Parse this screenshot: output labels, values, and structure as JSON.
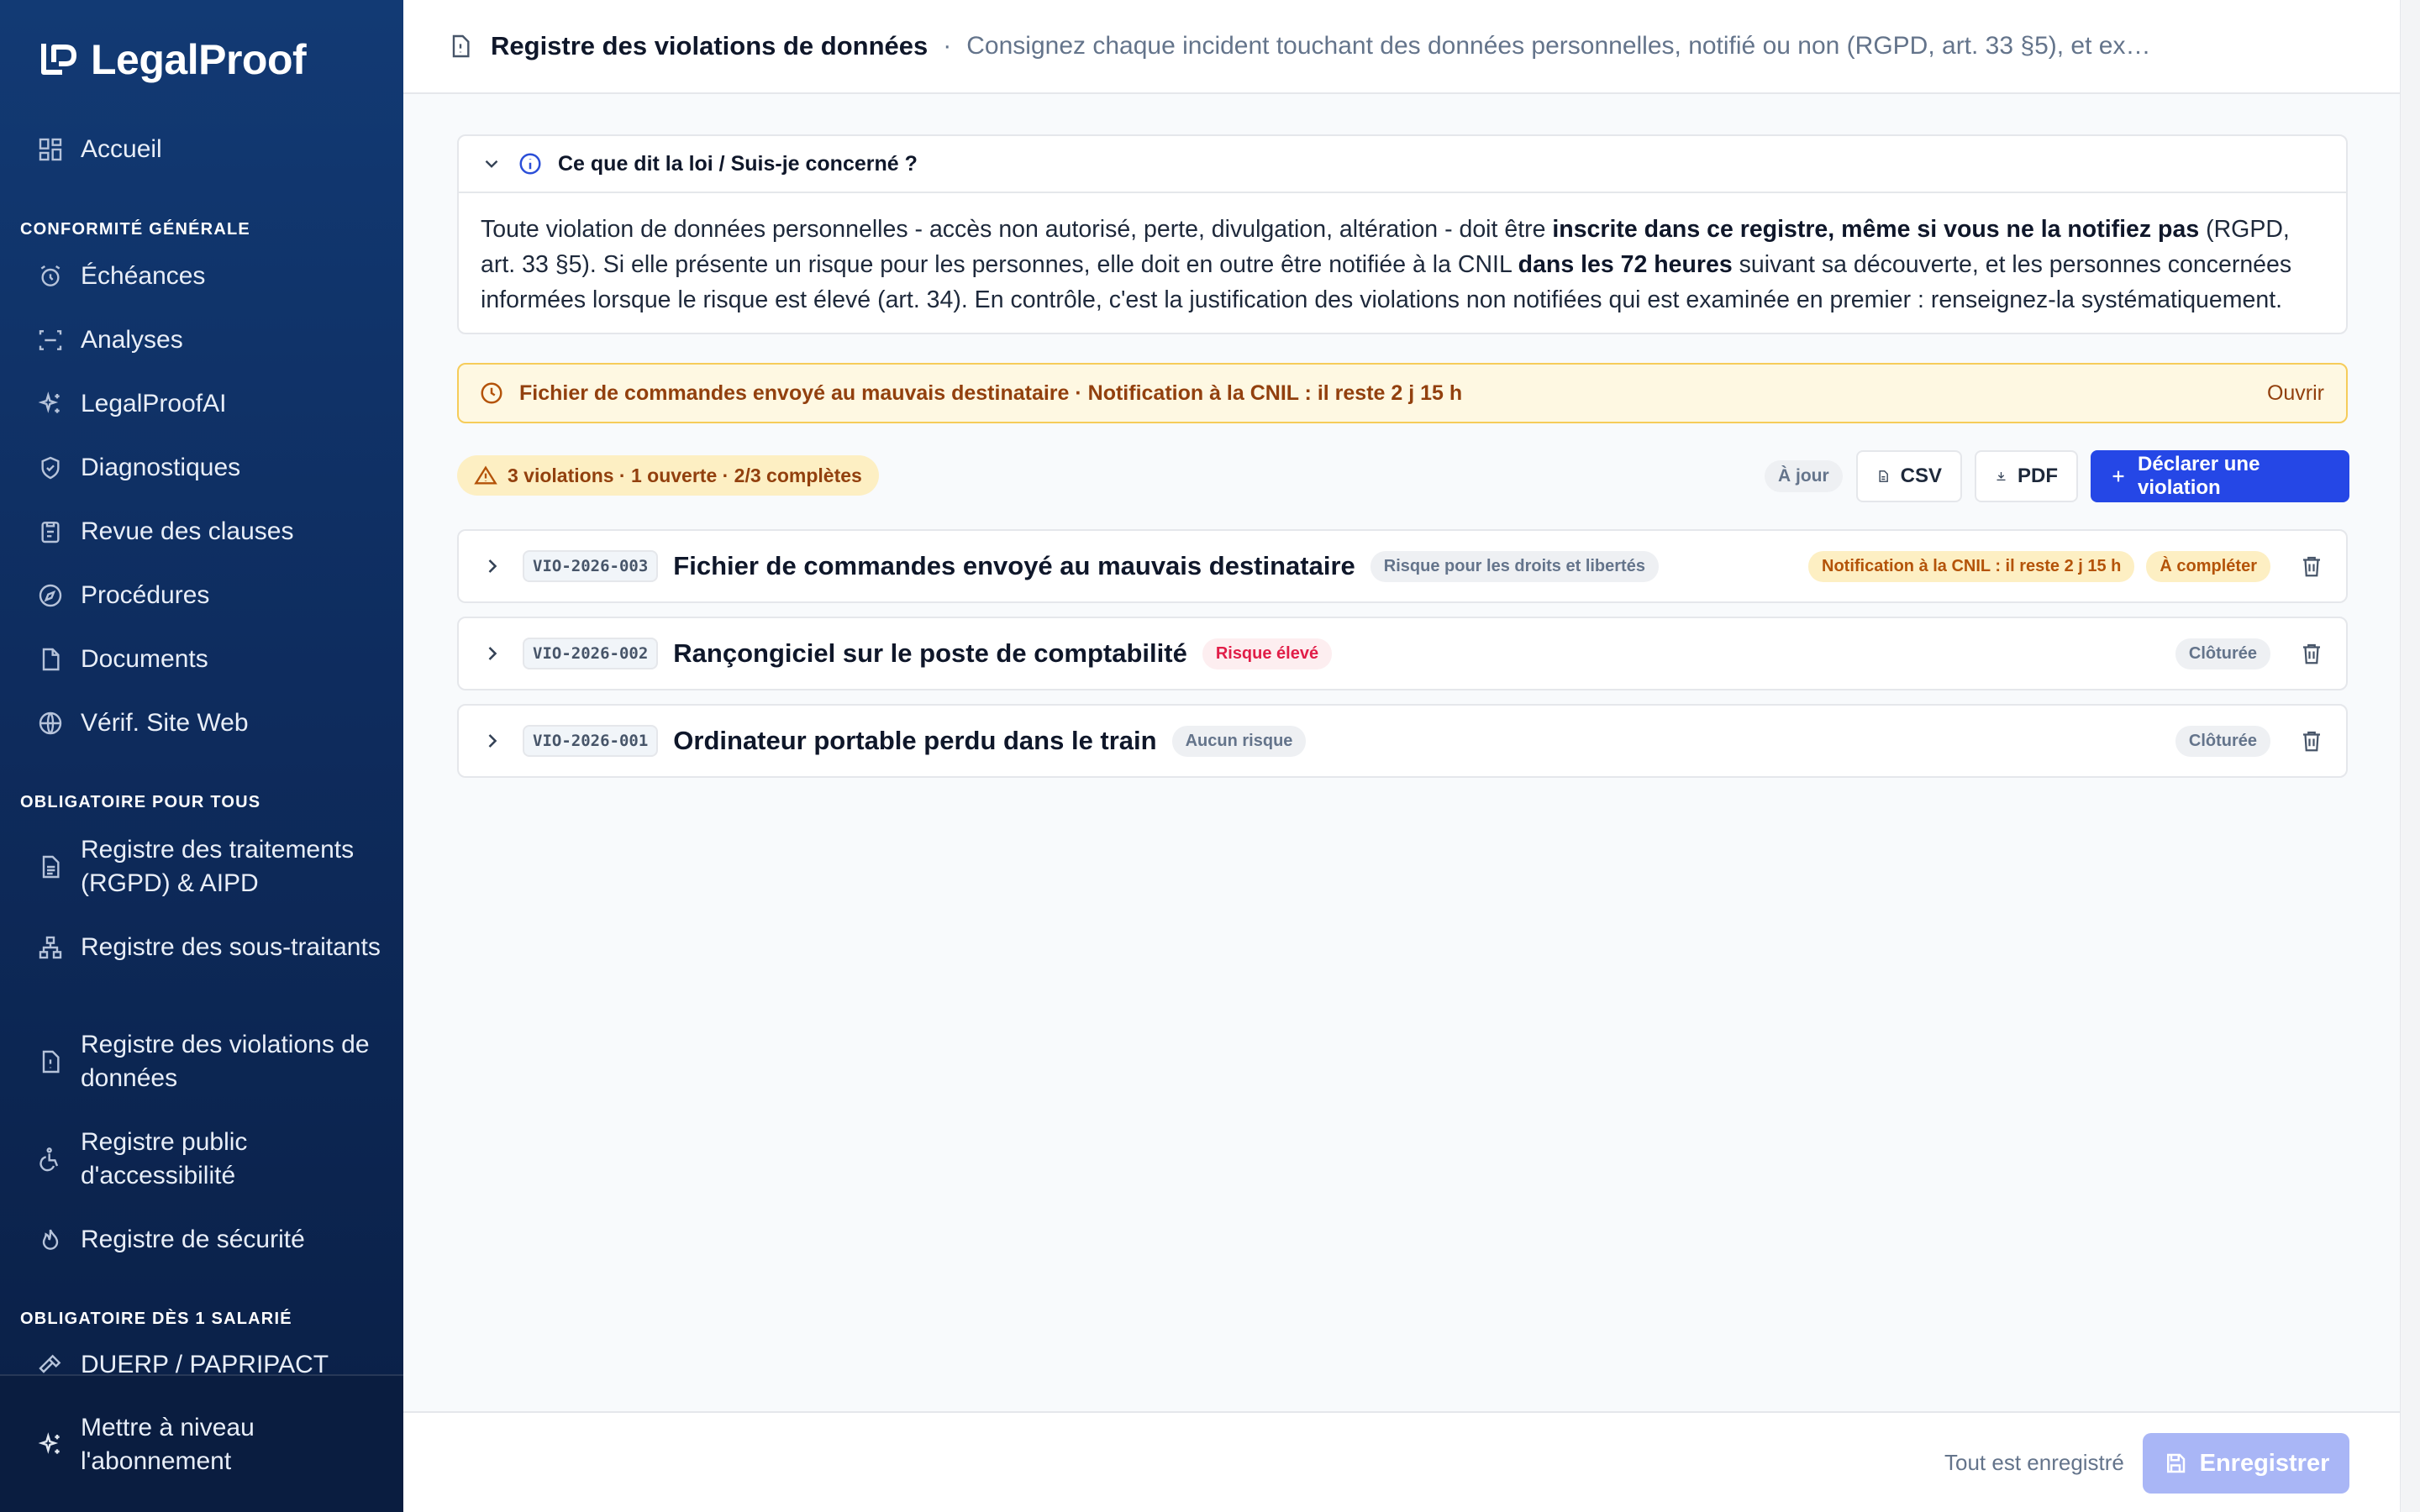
{
  "app": {
    "name": "LegalProof"
  },
  "sidebar": {
    "home": "Accueil",
    "sections": [
      {
        "title": "CONFORMITÉ GÉNÉRALE"
      },
      {
        "title": "OBLIGATOIRE POUR TOUS"
      },
      {
        "title": "OBLIGATOIRE DÈS 1 SALARIÉ"
      }
    ],
    "items": [
      {
        "label": "Échéances",
        "icon": "alarm-clock-icon"
      },
      {
        "label": "Analyses",
        "icon": "scan-icon"
      },
      {
        "label": "LegalProofAI",
        "icon": "sparkles-icon"
      },
      {
        "label": "Diagnostiques",
        "icon": "shield-check-icon"
      },
      {
        "label": "Revue des clauses",
        "icon": "clipboard-icon"
      },
      {
        "label": "Procédures",
        "icon": "compass-icon"
      },
      {
        "label": "Documents",
        "icon": "file-icon"
      },
      {
        "label": "Vérif. Site Web",
        "icon": "globe-icon"
      },
      {
        "label": "Registre des traitements (RGPD) & AIPD",
        "icon": "list-file-icon"
      },
      {
        "label": "Registre des sous-traitants",
        "icon": "network-icon"
      },
      {
        "label": "Registre des violations de données",
        "icon": "alert-file-icon"
      },
      {
        "label": "Registre public d'accessibilité",
        "icon": "accessibility-icon"
      },
      {
        "label": "Registre de sécurité",
        "icon": "flame-icon"
      },
      {
        "label": "DUERP / PAPRIPACT",
        "icon": "hammer-icon"
      }
    ],
    "upgrade": "Mettre à niveau l'abonnement"
  },
  "header": {
    "title": "Registre des violations de données",
    "separator": "·",
    "subtitle": "Consignez chaque incident touchant des données personnelles, notifié ou non (RGPD, art. 33 §5), et expo..."
  },
  "law": {
    "heading": "Ce que dit la loi / Suis-je concerné ?",
    "p1": "Toute violation de données personnelles - accès non autorisé, perte, divulgation, altération - doit être ",
    "b1": "inscrite dans ce registre, même si vous ne la notifiez pas",
    "p2": " (RGPD, art. 33 §5). Si elle présente un risque pour les personnes, elle doit en outre être notifiée à la CNIL ",
    "b2": "dans les 72 heures",
    "p3": " suivant sa découverte, et les personnes concernées informées lorsque le risque est élevé (art. 34). En contrôle, c'est la justification des violations non notifiées qui est examinée en premier : renseignez-la systématiquement."
  },
  "alert": {
    "text": "Fichier de commandes envoyé au mauvais destinataire · Notification à la CNIL : il reste 2 j 15 h",
    "action": "Ouvrir"
  },
  "toolbar": {
    "summary": "3 violations · 1 ouverte · 2/3 complètes",
    "status": "À jour",
    "csv": "CSV",
    "pdf": "PDF",
    "declare": "Déclarer une violation"
  },
  "violations": [
    {
      "id": "VIO-2026-003",
      "title": "Fichier de commandes envoyé au mauvais destinataire",
      "risk": "Risque pour les droits et libertés",
      "deadline": "Notification à la CNIL : il reste 2 j 15 h",
      "status": "À compléter"
    },
    {
      "id": "VIO-2026-002",
      "title": "Rançongiciel sur le poste de comptabilité",
      "risk": "Risque élevé",
      "status": "Clôturée"
    },
    {
      "id": "VIO-2026-001",
      "title": "Ordinateur portable perdu dans le train",
      "risk": "Aucun risque",
      "status": "Clôturée"
    }
  ],
  "footer": {
    "saved_status": "Tout est enregistré",
    "save": "Enregistrer"
  },
  "colors": {
    "primary": "#2547e6",
    "sidebar": "#0e2c5e",
    "warning_bg": "#fef8e2",
    "warning_text": "#92400e",
    "danger": "#e11d48"
  }
}
